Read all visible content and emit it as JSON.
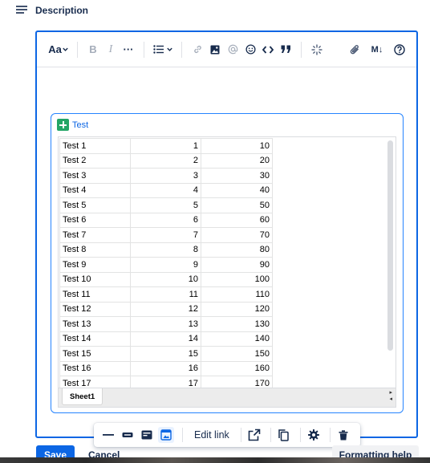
{
  "header": {
    "title": "Description",
    "icon": "description-icon"
  },
  "toolbar": {
    "text_style_label": "Aa",
    "bold": "B",
    "italic": "I",
    "more": "···",
    "markdown_label": "M↓"
  },
  "embed": {
    "title": "Test",
    "sheet_tab": "Sheet1",
    "rows": [
      [
        "Test 1",
        "1",
        "10"
      ],
      [
        "Test 2",
        "2",
        "20"
      ],
      [
        "Test 3",
        "3",
        "30"
      ],
      [
        "Test 4",
        "4",
        "40"
      ],
      [
        "Test 5",
        "5",
        "50"
      ],
      [
        "Test 6",
        "6",
        "60"
      ],
      [
        "Test 7",
        "7",
        "70"
      ],
      [
        "Test 8",
        "8",
        "80"
      ],
      [
        "Test 9",
        "9",
        "90"
      ],
      [
        "Test 10",
        "10",
        "100"
      ],
      [
        "Test 11",
        "11",
        "110"
      ],
      [
        "Test 12",
        "12",
        "120"
      ],
      [
        "Test 13",
        "13",
        "130"
      ],
      [
        "Test 14",
        "14",
        "140"
      ],
      [
        "Test 15",
        "15",
        "150"
      ],
      [
        "Test 16",
        "16",
        "160"
      ],
      [
        "Test 17",
        "17",
        "170"
      ]
    ]
  },
  "floating_toolbar": {
    "edit_link_label": "Edit link"
  },
  "actions": {
    "save": "Save",
    "cancel": "Cancel",
    "help": "Formatting help"
  },
  "colors": {
    "accent": "#0c66e4",
    "sheets_green": "#23a566"
  }
}
